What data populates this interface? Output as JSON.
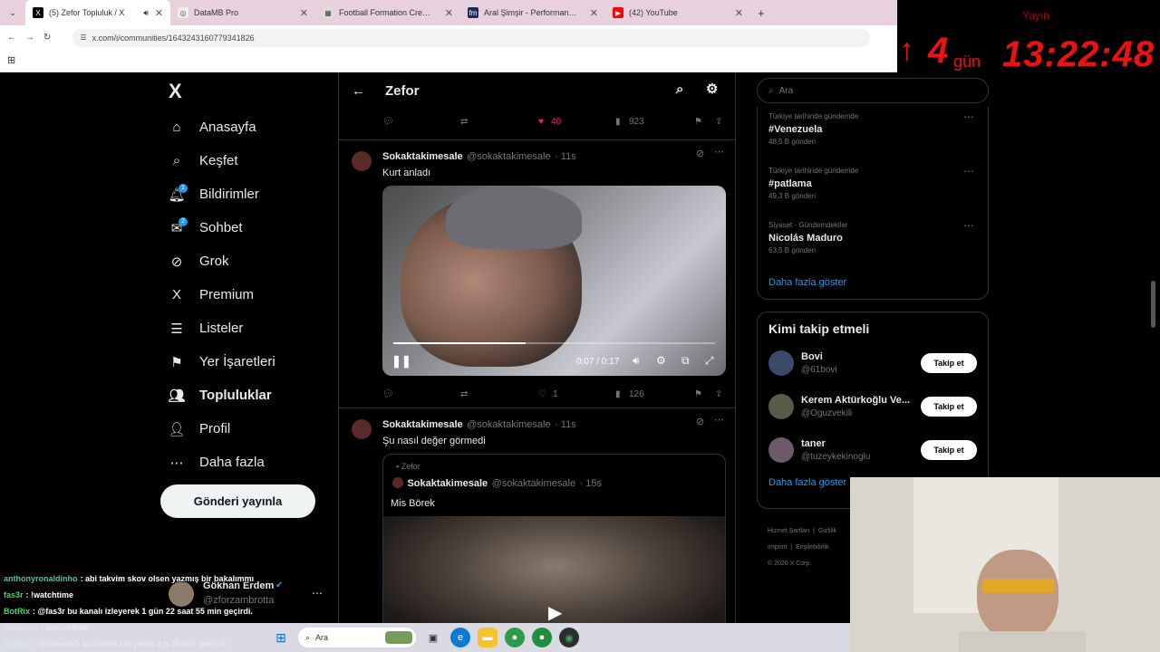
{
  "browser": {
    "tabs": [
      {
        "title": "(5) Zefor Topluluk / X",
        "fav": "X",
        "active": true
      },
      {
        "title": "DataMB Pro",
        "fav": "◎",
        "active": false
      },
      {
        "title": "Football Formation Creator: Re",
        "fav": "▦",
        "active": false
      },
      {
        "title": "Aral Şimşir - Performans bilgile",
        "fav": "fm",
        "active": false
      },
      {
        "title": "(42) YouTube",
        "fav": "▶",
        "active": false
      }
    ],
    "new_tab": "+",
    "url": "x.com/i/communities/1643243160779341826"
  },
  "overlay": {
    "label": "Yayın",
    "days_num": "4",
    "days_unit": "gün",
    "time": "13:22:48",
    "arrow": "↑"
  },
  "nav": {
    "items": [
      {
        "label": "Anasayfa",
        "icon": "⌂",
        "badge": ""
      },
      {
        "label": "Keşfet",
        "icon": "⌕",
        "badge": ""
      },
      {
        "label": "Bildirimler",
        "icon": "🔔︎",
        "badge": "1"
      },
      {
        "label": "Sohbet",
        "icon": "✉",
        "badge": "2"
      },
      {
        "label": "Grok",
        "icon": "⊘",
        "badge": ""
      },
      {
        "label": "Premium",
        "icon": "X",
        "badge": ""
      },
      {
        "label": "Listeler",
        "icon": "☰",
        "badge": ""
      },
      {
        "label": "Yer İşaretleri",
        "icon": "⚑",
        "badge": ""
      },
      {
        "label": "Topluluklar",
        "icon": "👥︎",
        "badge": ""
      },
      {
        "label": "Profil",
        "icon": "👤︎",
        "badge": ""
      },
      {
        "label": "Daha fazla",
        "icon": "⋯",
        "badge": ""
      }
    ],
    "post_button": "Gönderi yayınla",
    "account": {
      "name": "Gökhan Erdem",
      "handle": "@zforzambrotta"
    }
  },
  "main": {
    "title": "Zefor",
    "top_actions": {
      "likes": "40",
      "views": "923"
    },
    "tweets": [
      {
        "name": "Sokaktakimesale",
        "handle": "@sokaktakimesale",
        "time": "11s",
        "text": "Kurt anladı",
        "video_time": "0:07 / 0:17",
        "video_progress": 0.41,
        "likes": "1",
        "views": "126"
      },
      {
        "name": "Sokaktakimesale",
        "handle": "@sokaktakimesale",
        "time": "11s",
        "text": "Şu nasıl değer görmedi",
        "quote": {
          "community": "Zefor",
          "name": "Sokaktakimesale",
          "handle": "@sokaktakimesale",
          "time": "15s",
          "text": "Mis Börek"
        }
      }
    ]
  },
  "right": {
    "search_placeholder": "Ara",
    "trends": [
      {
        "meta": "Türkiye tarihinde gündemde",
        "name": "#Venezuela",
        "count": "48,5 B gönderi"
      },
      {
        "meta": "Türkiye tarihinde gündemde",
        "name": "#patlama",
        "count": "49,3 B gönderi"
      },
      {
        "meta": "Siyaset · Gündemdekiler",
        "name": "Nicolás Maduro",
        "count": "63,5 B gönderi"
      }
    ],
    "show_more": "Daha fazla göster",
    "who_title": "Kimi takip etmeli",
    "who": [
      {
        "name": "Bovi",
        "handle": "@61bovi"
      },
      {
        "name": "Kerem Aktürkoğlu Ve...",
        "handle": "@Oguzvekili"
      },
      {
        "name": "taner",
        "handle": "@tuzeykekinoglu"
      }
    ],
    "follow_label": "Takip et",
    "show_more2": "Daha fazla göster",
    "footer": [
      "Hizmet Şartları",
      "Gizlilik",
      "Imprint",
      "Erişilebilirlik",
      "© 2026 X Corp."
    ]
  },
  "chat": {
    "lines": [
      {
        "user": "anthonyronaldinho",
        "msg": ": abi takvim skov olsen yazmış bir bakalımmı",
        "color": "#41c9a0"
      },
      {
        "user": "fas3r",
        "msg": ": !watchtime",
        "color": "#3fdc60"
      },
      {
        "user": "BotRix",
        "msg": ": @fas3r bu kanalı izleyerek 1 gün 22 saat 55 min geçirdi.",
        "color": "#3fdc60"
      },
      {
        "user": "dilhannS",
        "msg": ": !watchtime",
        "color": "#d64"
      },
      {
        "user": "BotRix",
        "msg": ": @dilhannS bu kanalı izleyerek 2 h 30 min geçirdi.",
        "color": "#3fdc60"
      }
    ]
  },
  "taskbar": {
    "search": "Ara"
  }
}
